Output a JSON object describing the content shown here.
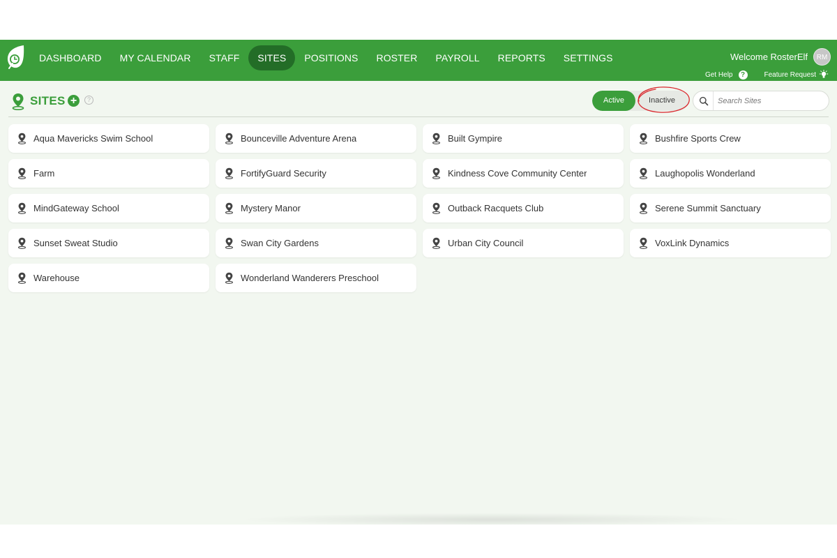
{
  "nav": {
    "items": [
      {
        "label": "DASHBOARD",
        "active": false
      },
      {
        "label": "MY CALENDAR",
        "active": false
      },
      {
        "label": "STAFF",
        "active": false
      },
      {
        "label": "SITES",
        "active": true
      },
      {
        "label": "POSITIONS",
        "active": false
      },
      {
        "label": "ROSTER",
        "active": false
      },
      {
        "label": "PAYROLL",
        "active": false
      },
      {
        "label": "REPORTS",
        "active": false
      },
      {
        "label": "SETTINGS",
        "active": false
      }
    ]
  },
  "user": {
    "welcome": "Welcome RosterElf",
    "initials": "RM"
  },
  "help": {
    "get_help": "Get Help",
    "get_help_icon": "?",
    "feature_request": "Feature Request"
  },
  "page": {
    "title": "SITES",
    "add_icon": "+",
    "help_icon": "?"
  },
  "filter": {
    "active_label": "Active",
    "inactive_label": "Inactive",
    "selected": "Active"
  },
  "search": {
    "placeholder": "Search Sites",
    "value": ""
  },
  "sites": [
    {
      "name": "Aqua Mavericks Swim School"
    },
    {
      "name": "Bounceville Adventure Arena"
    },
    {
      "name": "Built Gympire"
    },
    {
      "name": "Bushfire Sports Crew"
    },
    {
      "name": "Farm"
    },
    {
      "name": "FortifyGuard Security"
    },
    {
      "name": "Kindness Cove Community Center"
    },
    {
      "name": "Laughopolis Wonderland"
    },
    {
      "name": "MindGateway School"
    },
    {
      "name": "Mystery Manor"
    },
    {
      "name": "Outback Racquets Club"
    },
    {
      "name": "Serene Summit Sanctuary"
    },
    {
      "name": "Sunset Sweat Studio"
    },
    {
      "name": "Swan City Gardens"
    },
    {
      "name": "Urban City Council"
    },
    {
      "name": "VoxLink Dynamics"
    },
    {
      "name": "Warehouse"
    },
    {
      "name": "Wonderland Wanderers Preschool"
    }
  ],
  "colors": {
    "brand_green": "#3b9e3b",
    "active_nav": "#236d27",
    "page_bg": "#f2f7f0",
    "highlight_ring": "#d9262c"
  },
  "icons": {
    "logo": "leaf-clock-logo",
    "site": "map-pin-icon",
    "search": "search-icon",
    "bulb": "lightbulb-icon"
  }
}
